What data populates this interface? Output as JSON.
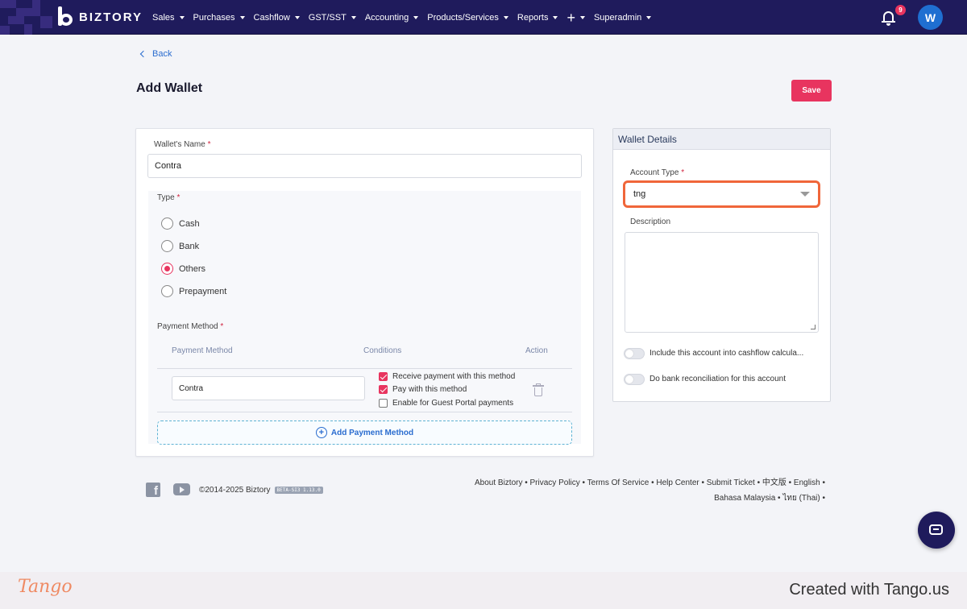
{
  "nav": {
    "logo_text": "BIZTORY",
    "menu": [
      {
        "label": "Sales"
      },
      {
        "label": "Purchases"
      },
      {
        "label": "Cashflow"
      },
      {
        "label": "GST/SST"
      },
      {
        "label": "Accounting"
      },
      {
        "label": "Products/Services"
      },
      {
        "label": "Reports"
      },
      {
        "label": "+"
      },
      {
        "label": "Superadmin"
      }
    ],
    "notification_count": "9",
    "avatar_initial": "W"
  },
  "page": {
    "back_label": "Back",
    "title": "Add Wallet",
    "save_label": "Save"
  },
  "form": {
    "wallet_name_label": "Wallet's Name",
    "wallet_name_value": "Contra",
    "required_mark": "*",
    "type_label": "Type",
    "type_options": [
      "Cash",
      "Bank",
      "Others",
      "Prepayment"
    ],
    "type_selected": "Others",
    "payment_method_label": "Payment Method",
    "pm_columns": [
      "Payment Method",
      "Conditions",
      "Action"
    ],
    "pm_rows": [
      {
        "method": "Contra",
        "conditions": [
          {
            "label": "Receive payment with this method",
            "checked": true
          },
          {
            "label": "Pay with this method",
            "checked": true
          },
          {
            "label": "Enable for Guest Portal payments",
            "checked": false
          }
        ]
      }
    ],
    "add_pm_label": "Add Payment Method"
  },
  "details": {
    "header": "Wallet Details",
    "account_type_label": "Account Type",
    "account_type_value": "tng",
    "description_label": "Description",
    "description_value": "",
    "toggle_cashflow_label": "Include this account into cashflow calcula...",
    "toggle_cashflow_on": false,
    "toggle_bank_label": "Do bank reconciliation for this account",
    "toggle_bank_on": false
  },
  "footer": {
    "copyright": "©2014-2025 Biztory",
    "beta_badge": "BETA-SI3 1.13.0",
    "links_line1": "About Biztory • Privacy Policy • Terms Of Service • Help Center • Submit Ticket • 中文版 • English •",
    "links_line2": "Bahasa Malaysia • ไทย (Thai) •"
  },
  "tango": {
    "logo": "Tango",
    "credit": "Created with Tango.us"
  },
  "colors": {
    "nav_bg": "#1f1b5c",
    "accent": "#e8345f",
    "link": "#2a6ccf",
    "highlight": "#f0663a"
  }
}
